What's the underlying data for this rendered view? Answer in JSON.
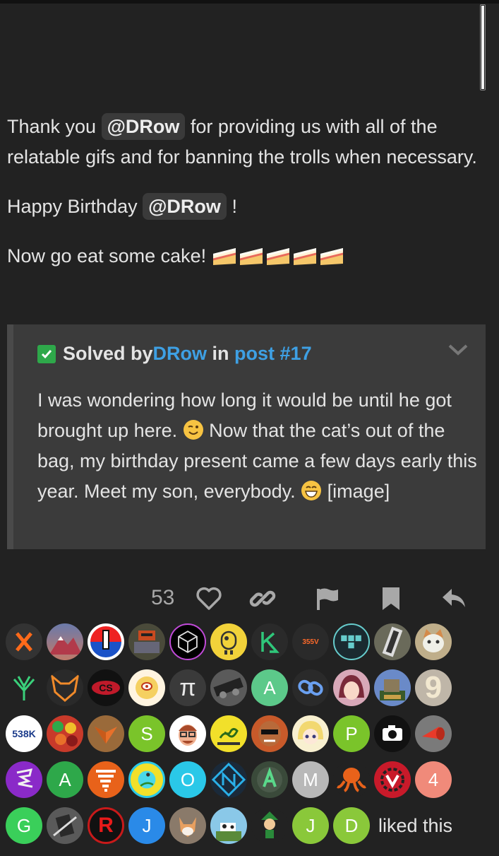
{
  "post": {
    "p1_before": "Thank you ",
    "mention1": "@DRow",
    "p1_after": " for providing us with all of the relatable gifs and for banning the trolls when necessary.",
    "p2_before": "Happy Birthday ",
    "mention2": "@DRow",
    "p2_after": " !",
    "p3": "Now go eat some cake! "
  },
  "quote": {
    "solved_by": "Solved by ",
    "author": "DRow",
    "in": " in ",
    "post_link": "post #17",
    "body_1": "I was wondering how long it would be until he got brought up here. ",
    "body_2": " Now that the cat’s out of the bag, my birthday present came a few days early this year. Meet my son, everybody. ",
    "body_3": " [image]"
  },
  "actions": {
    "like_count": "53"
  },
  "avatars": {
    "letters": {
      "s": "S",
      "a1": "A",
      "p": "P",
      "a2": "A",
      "o": "O",
      "m": "M",
      "n4": "4",
      "g": "G",
      "r": "R",
      "j1": "J",
      "j2": "J",
      "d": "D",
      "nine": "9",
      "pi": "π",
      "k538": "538K",
      "v355": "355V"
    },
    "liked_text": "liked this"
  },
  "colors": {
    "background": "#222222",
    "quote_bg": "#3b3b3b",
    "link": "#3ea0e4",
    "solved_green": "#2ea84a",
    "mention_bg": "#3a3a3a"
  }
}
